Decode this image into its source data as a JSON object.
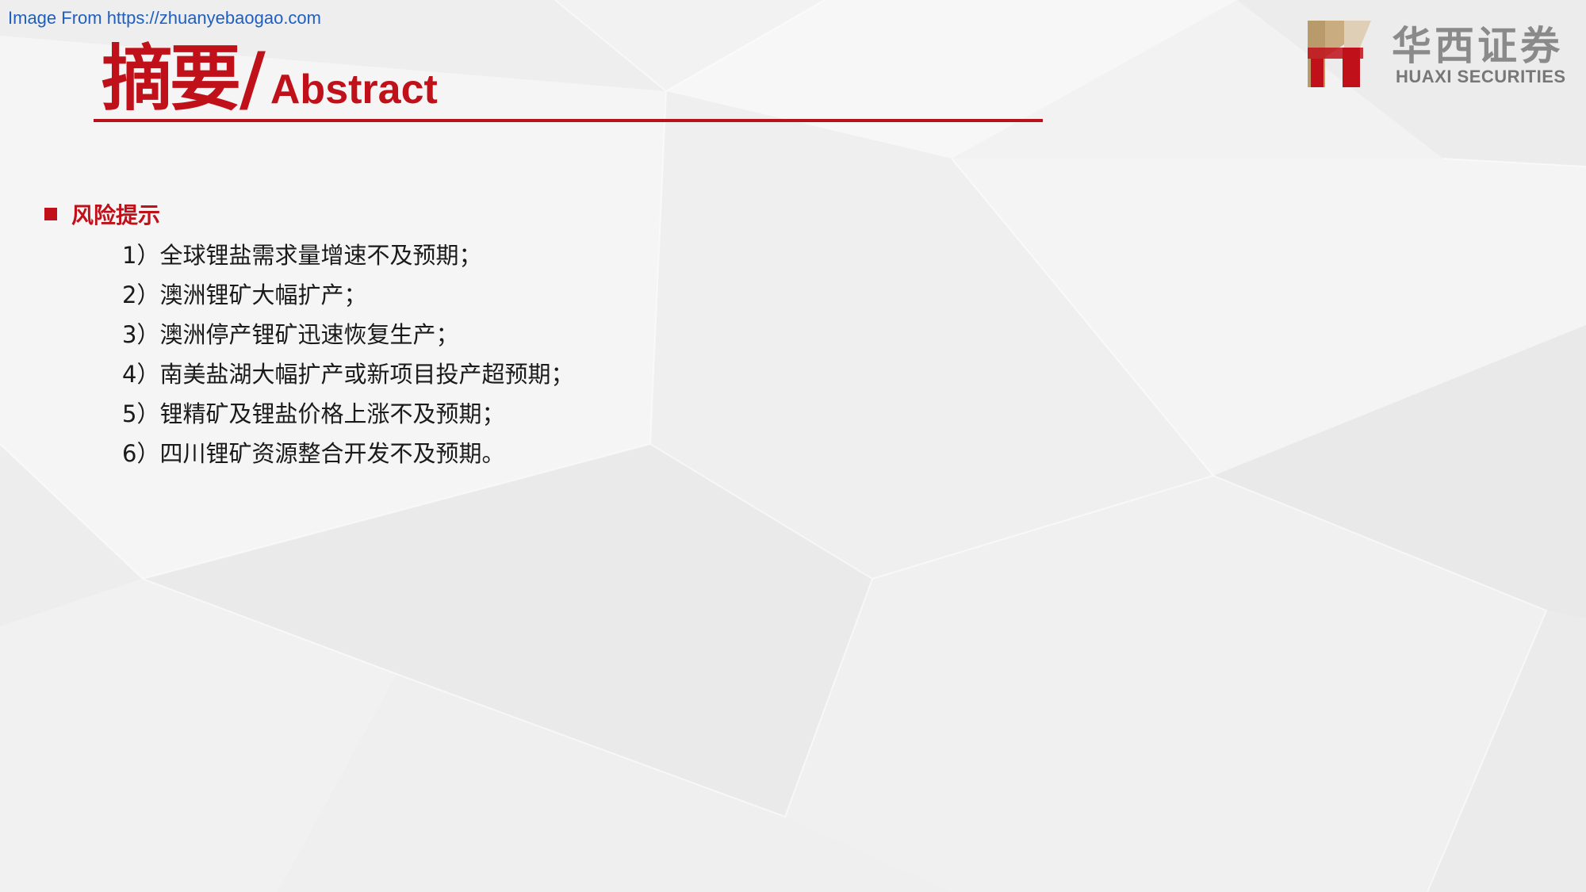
{
  "source_note": "Image From https://zhuanyebaogao.com",
  "title": {
    "cn": "摘要",
    "slash": "/",
    "en": "Abstract"
  },
  "logo": {
    "cn": "华西证券",
    "en": "HUAXI SECURITIES"
  },
  "colors": {
    "accent": "#c0111a",
    "body_text": "#1a1a1a",
    "logo_gray": "#8a8a8a",
    "logo_gold": "#b99a6a"
  },
  "section": {
    "title": "风险提示",
    "items": [
      "1）全球锂盐需求量增速不及预期；",
      "2）澳洲锂矿大幅扩产；",
      "3）澳洲停产锂矿迅速恢复生产；",
      "4）南美盐湖大幅扩产或新项目投产超预期；",
      "5）锂精矿及锂盐价格上涨不及预期；",
      "6）四川锂矿资源整合开发不及预期。"
    ]
  }
}
